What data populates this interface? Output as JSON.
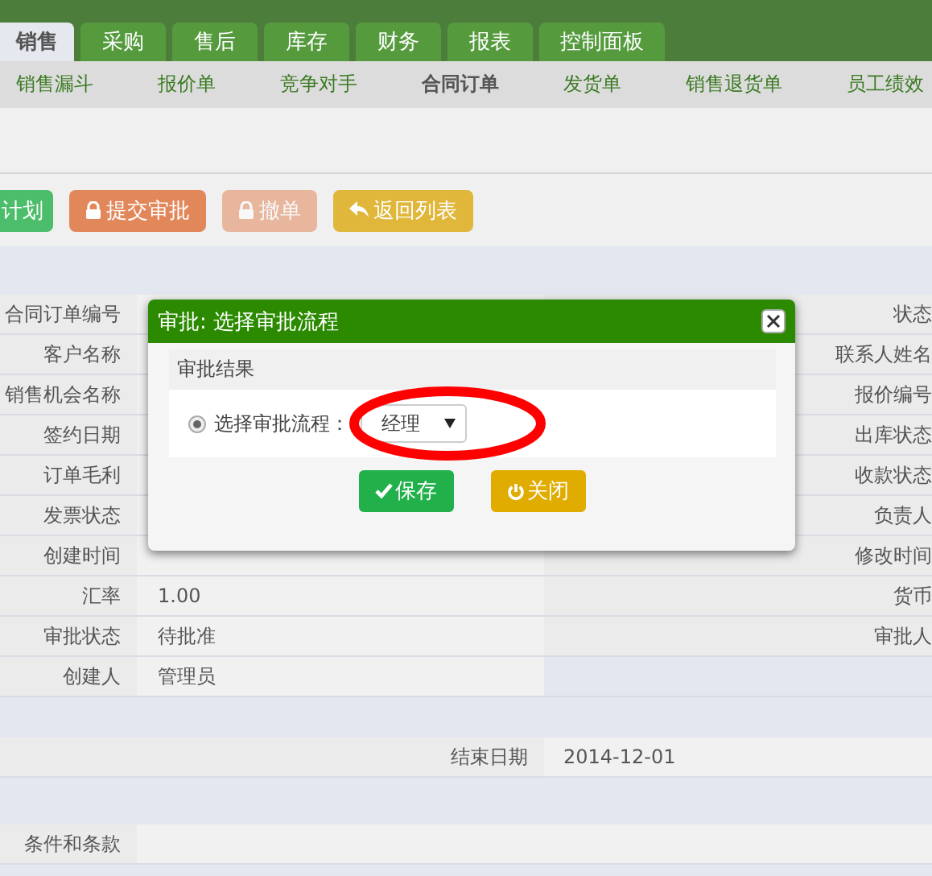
{
  "top_tabs": [
    {
      "label": "销售",
      "selected": true
    },
    {
      "label": "采购",
      "selected": false
    },
    {
      "label": "售后",
      "selected": false
    },
    {
      "label": "库存",
      "selected": false
    },
    {
      "label": "财务",
      "selected": false
    },
    {
      "label": "报表",
      "selected": false
    },
    {
      "label": "控制面板",
      "selected": false
    }
  ],
  "sub_nav": [
    {
      "label": "销售漏斗",
      "selected": false
    },
    {
      "label": "报价单",
      "selected": false
    },
    {
      "label": "竞争对手",
      "selected": false
    },
    {
      "label": "合同订单",
      "selected": true
    },
    {
      "label": "发货单",
      "selected": false
    },
    {
      "label": "销售退货单",
      "selected": false
    },
    {
      "label": "员工绩效",
      "selected": false
    }
  ],
  "toolbar": [
    {
      "label": "计划",
      "kind": "plan",
      "disabled": false
    },
    {
      "label": "提交审批",
      "kind": "submit",
      "disabled": false
    },
    {
      "label": "撤单",
      "kind": "withdraw",
      "disabled": true
    },
    {
      "label": "返回列表",
      "kind": "back",
      "disabled": false
    }
  ],
  "form_rows": [
    {
      "label": "合同订单编号",
      "right_label": "状态"
    },
    {
      "label": "客户名称",
      "right_label": "联系人姓名"
    },
    {
      "label": "销售机会名称",
      "right_label": "报价编号"
    },
    {
      "label": "签约日期",
      "right_label": "出库状态"
    },
    {
      "label": "订单毛利",
      "right_label": "收款状态"
    },
    {
      "label": "发票状态",
      "right_label": "负责人"
    },
    {
      "label": "创建时间",
      "right_label": "修改时间"
    },
    {
      "label": "汇率",
      "value": "1.00",
      "right_label": "货币"
    },
    {
      "label": "审批状态",
      "value": "待批准",
      "right_label": "审批人"
    },
    {
      "label": "创建人",
      "value": "管理员"
    }
  ],
  "date_row": {
    "label": "结束日期",
    "value": "2014-12-01"
  },
  "terms_row": {
    "label": "条件和条款"
  },
  "dialog": {
    "title": "审批: 选择审批流程",
    "section_title": "审批结果",
    "field": {
      "label": "选择审批流程：",
      "checked": true,
      "value": "经理"
    },
    "buttons": [
      {
        "label": "保存",
        "kind": "save"
      },
      {
        "label": "关闭",
        "kind": "close"
      }
    ]
  }
}
